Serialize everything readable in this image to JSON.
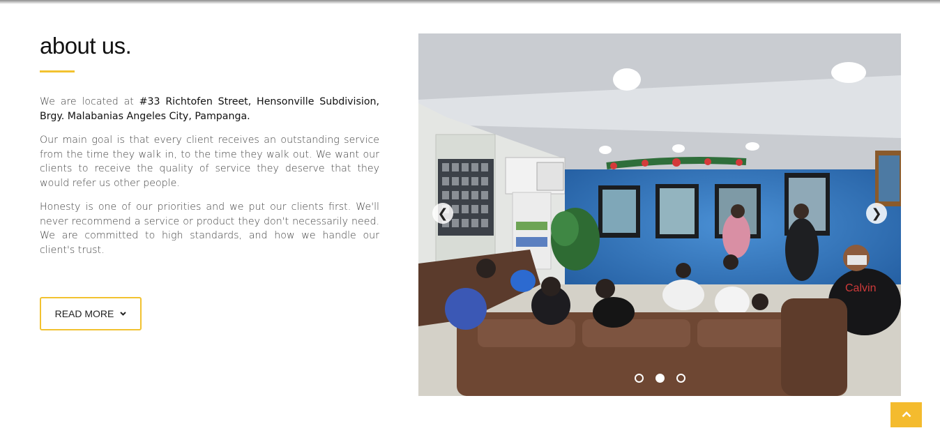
{
  "about": {
    "heading": "about us.",
    "location_prefix": "We are located at ",
    "location_address": "#33 Richtofen Street, Hensonville Subdivision, Brgy. Malabanias Angeles City, Pampanga.",
    "paragraph_goal": "Our main goal is that every client receives an outstanding service from the time they walk in, to the time they walk out. We want our clients to receive the quality of service they deserve that they would refer us other people.",
    "paragraph_honesty": "Honesty is one of our priorities and we put our clients first. We'll never recommend a service or product they don't necessarily need. We are committed to high standards, and how we handle our client's trust.",
    "read_more_label": "READ MORE",
    "accent_color": "#f2c230"
  },
  "carousel": {
    "prev_icon": "chevron-left-icon",
    "next_icon": "chevron-right-icon",
    "slide_count": 3,
    "active_slide": 2,
    "brand_on_shirt": "Calvin"
  },
  "scroll_top": {
    "icon": "chevron-up-icon",
    "color": "#f4bb2e"
  }
}
